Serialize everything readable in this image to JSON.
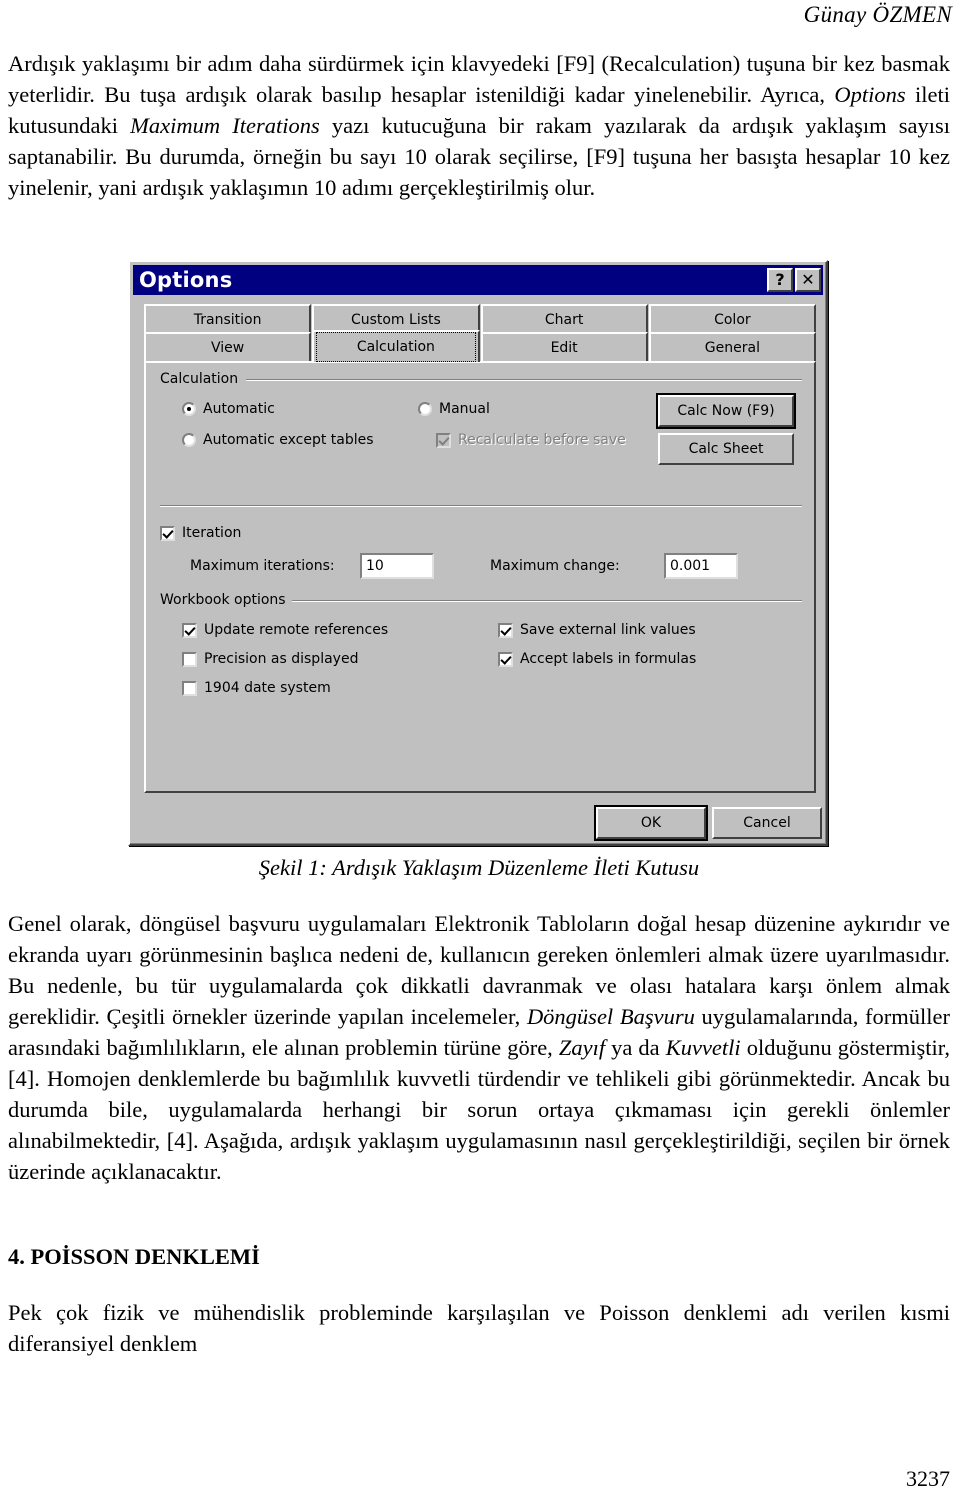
{
  "document": {
    "running_head": "Günay ÖZMEN",
    "page_number": "3237",
    "paragraph1_part1": "Ardışık yaklaşımı bir adım daha sürdürmek için klavyedeki [F9] (Recalculation) tuşuna bir kez basmak yeterlidir. Bu tuşa ardışık olarak basılıp hesaplar istenildiği kadar yinelenebilir. Ayrıca, ",
    "paragraph1_italic1": "Options",
    "paragraph1_part2": " ileti kutusundaki ",
    "paragraph1_italic2": "Maximum Iterations",
    "paragraph1_part3": " yazı kutucuğuna bir rakam yazılarak da ardışık yaklaşım sayısı saptanabilir. Bu durumda, örneğin bu sayı 10 olarak seçilirse, [F9] tuşuna her basışta hesaplar 10 kez yinelenir, yani ardışık yaklaşımın 10 adımı gerçekleştirilmiş olur.",
    "figure_caption": "Şekil 1: Ardışık Yaklaşım Düzenleme İleti Kutusu",
    "paragraph2_part1": "Genel olarak, döngüsel başvuru uygulamaları Elektronik Tabloların doğal hesap düzenine aykırıdır ve ekranda uyarı görünmesinin başlıca nedeni de, kullanıcın gereken önlemleri almak üzere uyarılmasıdır. Bu nedenle, bu tür uygulamalarda çok dikkatli davranmak ve olası hatalara karşı önlem almak gereklidir. Çeşitli örnekler üzerinde yapılan incelemeler, ",
    "paragraph2_italic1": "Döngüsel Başvuru",
    "paragraph2_part2": " uygulamalarında, formüller arasındaki bağımlılıkların, ele alınan problemin türüne göre, ",
    "paragraph2_italic2": "Zayıf",
    "paragraph2_part3": " ya da ",
    "paragraph2_italic3": "Kuvvetli",
    "paragraph2_part4": " olduğunu göstermiştir, [4]. Homojen denklemlerde bu bağımlılık kuvvetli türdendir ve tehlikeli gibi görünmektedir. Ancak bu durumda bile, uygulamalarda herhangi bir sorun ortaya çıkmaması için gerekli önlemler alınabilmektedir, [4]. Aşağıda, ardışık yaklaşım uygulamasının nasıl gerçekleştirildiği, seçilen bir örnek üzerinde açıklanacaktır.",
    "section_heading": "4. POİSSON DENKLEMİ",
    "paragraph3": "Pek çok fizik ve mühendislik probleminde karşılaşılan ve Poisson denklemi adı verilen kısmi diferansiyel denklem"
  },
  "dialog": {
    "title": "Options",
    "titlebar_help": "?",
    "titlebar_close": "✕",
    "tabs_row1": [
      {
        "label": "Transition",
        "active": false
      },
      {
        "label": "Custom Lists",
        "active": false
      },
      {
        "label": "Chart",
        "active": false
      },
      {
        "label": "Color",
        "active": false
      }
    ],
    "tabs_row2": [
      {
        "label": "View",
        "active": false
      },
      {
        "label": "Calculation",
        "active": true
      },
      {
        "label": "Edit",
        "active": false
      },
      {
        "label": "General",
        "active": false
      }
    ],
    "calculation_group": {
      "label": "Calculation",
      "radio_automatic": "Automatic",
      "radio_automatic_checked": true,
      "radio_automatic_except_tables": "Automatic except tables",
      "radio_automatic_except_tables_checked": false,
      "radio_manual": "Manual",
      "radio_manual_checked": false,
      "check_recalculate_before_save": "Recalculate before save",
      "check_recalculate_before_save_checked": true,
      "check_recalculate_before_save_disabled": true,
      "button_calc_now": "Calc Now (F9)",
      "button_calc_sheet": "Calc Sheet"
    },
    "iteration_group": {
      "check_iteration": "Iteration",
      "check_iteration_checked": true,
      "label_max_iterations": "Maximum iterations:",
      "value_max_iterations": "10",
      "label_max_change": "Maximum change:",
      "value_max_change": "0.001"
    },
    "workbook_group": {
      "label": "Workbook options",
      "check_update_remote_references": "Update remote references",
      "check_update_remote_references_checked": true,
      "check_precision_as_displayed": "Precision as displayed",
      "check_precision_as_displayed_checked": false,
      "check_1904_date_system": "1904 date system",
      "check_1904_date_system_checked": false,
      "check_save_external_link_values": "Save external link values",
      "check_save_external_link_values_checked": true,
      "check_accept_labels_in_formulas": "Accept labels in formulas",
      "check_accept_labels_in_formulas_checked": true
    },
    "footer": {
      "ok": "OK",
      "cancel": "Cancel"
    },
    "colors": {
      "titlebar": "#000080",
      "face": "#c0c0c0",
      "shadow": "#808080",
      "highlight": "#ffffff"
    }
  }
}
